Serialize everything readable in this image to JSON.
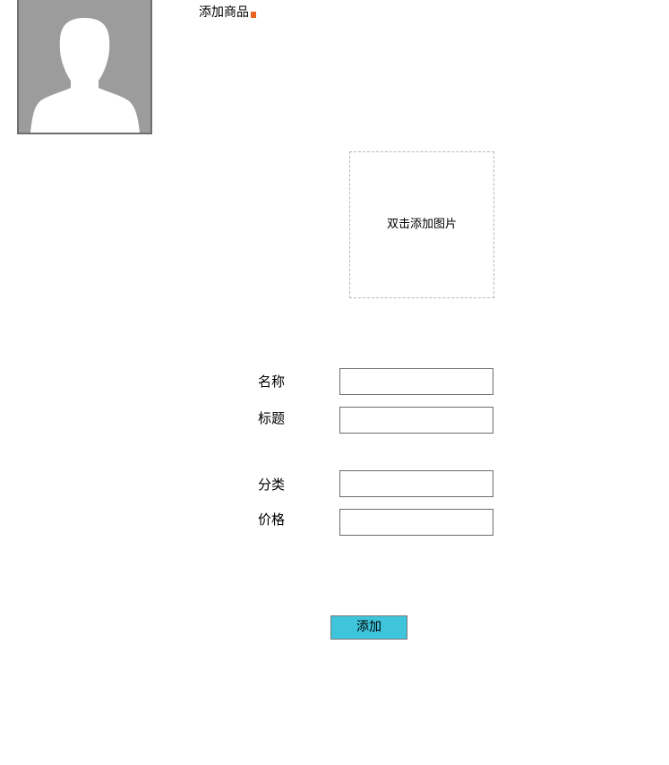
{
  "header": {
    "title": "添加商品",
    "avatar_icon": "user-silhouette-icon"
  },
  "image_upload": {
    "label": "双击添加图片"
  },
  "form": {
    "fields": [
      {
        "label": "名称",
        "value": "",
        "placeholder": ""
      },
      {
        "label": "标题",
        "value": "",
        "placeholder": ""
      },
      {
        "label": "分类",
        "value": "",
        "placeholder": ""
      },
      {
        "label": "价格",
        "value": "",
        "placeholder": ""
      }
    ],
    "submit_label": "添加"
  },
  "colors": {
    "avatar_bg": "#9c9c9c",
    "avatar_border": "#6e6e6e",
    "button_bg": "#3ec4db",
    "title_marker": "#e8641e"
  }
}
